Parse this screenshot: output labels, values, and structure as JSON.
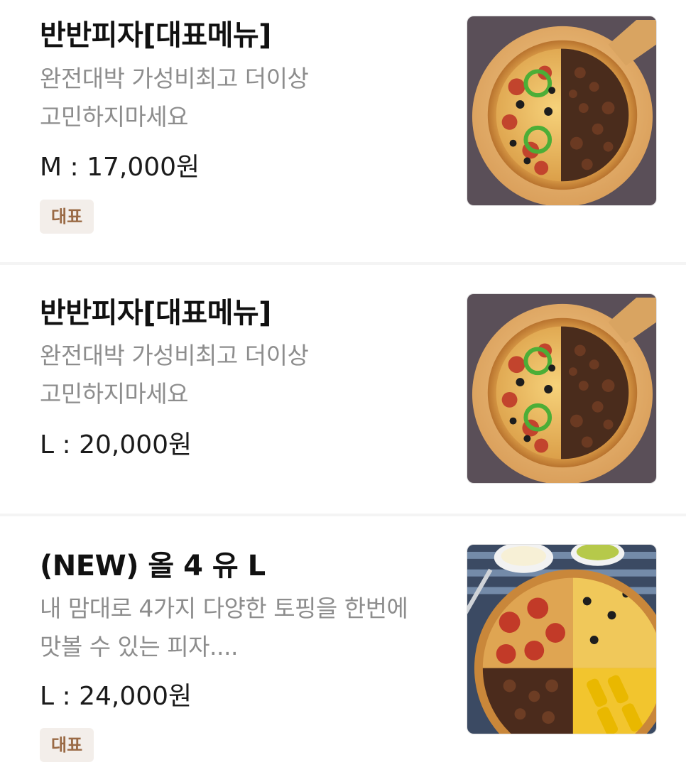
{
  "menu": {
    "items": [
      {
        "name": "반반피자[대표메뉴]",
        "description_lines": [
          "완전대박 가성비최고 더이상",
          "고민하지마세요"
        ],
        "price": "M : 17,000원",
        "badge": "대표",
        "image_icon": "half-and-half-pizza-photo"
      },
      {
        "name": "반반피자[대표메뉴]",
        "description_lines": [
          "완전대박 가성비최고 더이상",
          "고민하지마세요"
        ],
        "price": "L : 20,000원",
        "image_icon": "half-and-half-pizza-photo"
      },
      {
        "name": "(NEW) 올 4 유 L",
        "description_lines": [
          "내 맘대로 4가지 다양한 토핑을 한번에",
          "맛볼 수 있는 피자...."
        ],
        "price": "L : 24,000원",
        "badge": "대표",
        "image_icon": "four-topping-pizza-photo"
      }
    ]
  },
  "colors": {
    "badge_background": "#f3eeea",
    "badge_text": "#9a6a45",
    "description_text": "#8d8d8d",
    "divider": "#f4f4f4"
  }
}
